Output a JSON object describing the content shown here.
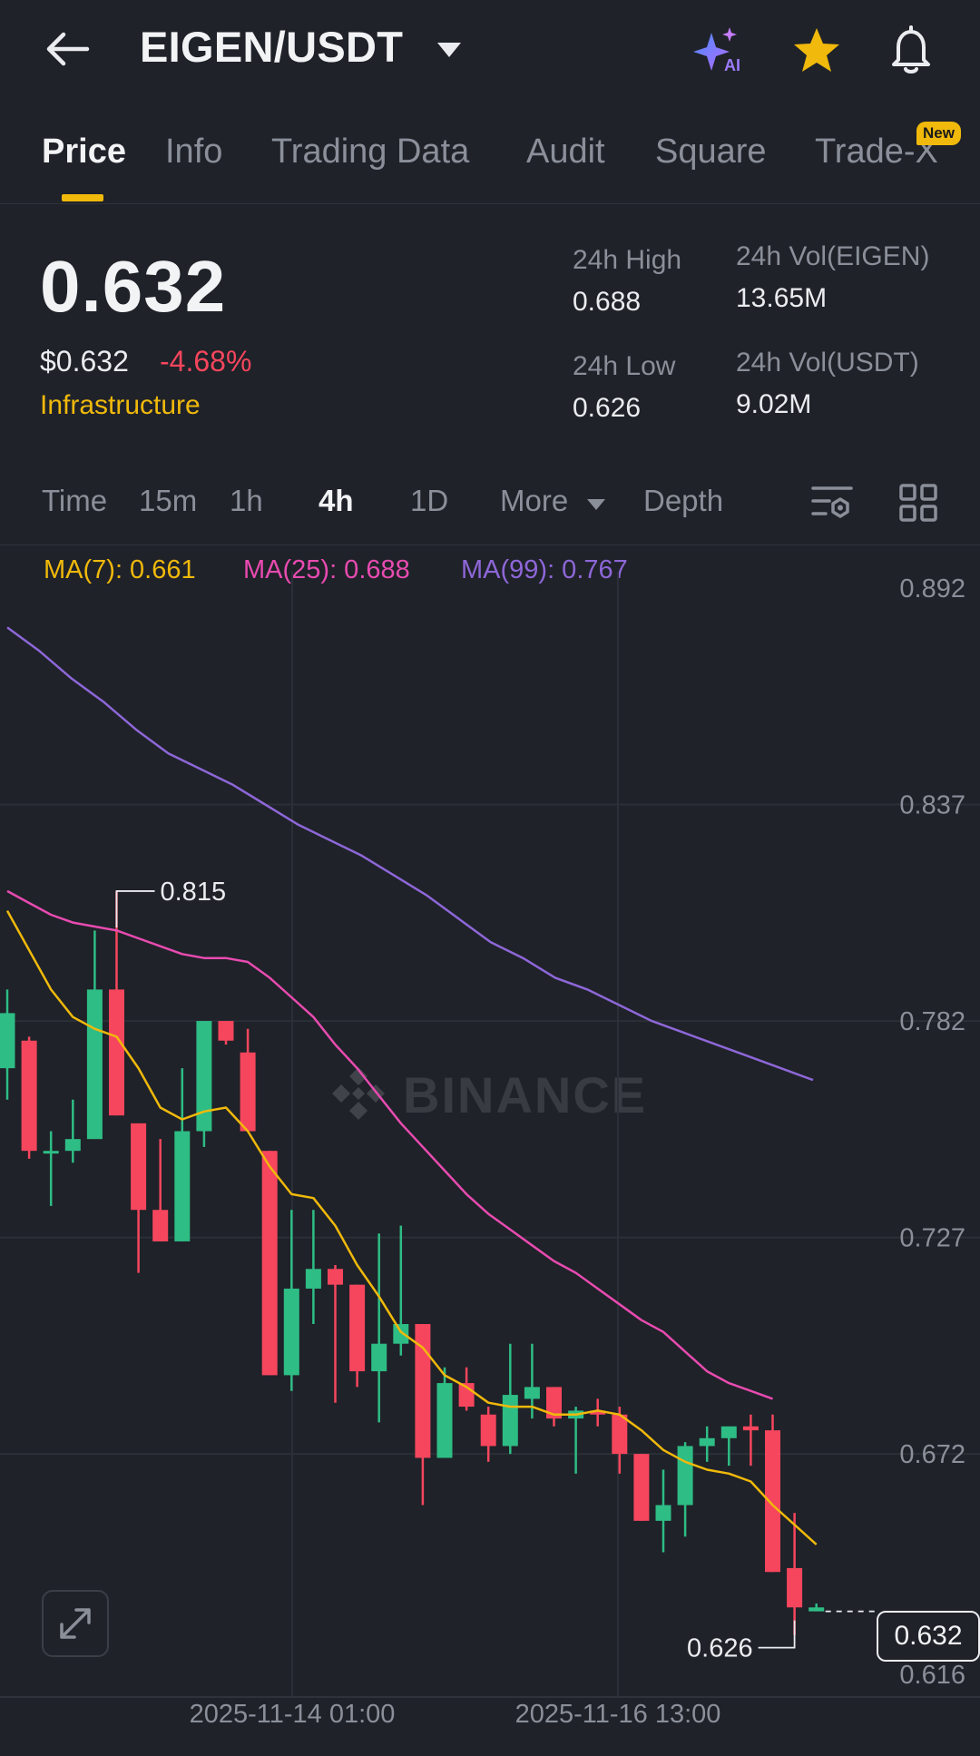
{
  "header": {
    "pair": "EIGEN/USDT",
    "icons": {
      "back": "arrow-left-icon",
      "caret": "caret-down-icon",
      "ai": "ai-sparkle-icon",
      "favorite": "star-icon",
      "alert": "bell-icon"
    },
    "favorite_color": "#f0b90b"
  },
  "tabs": [
    {
      "label": "Price",
      "active": true
    },
    {
      "label": "Info"
    },
    {
      "label": "Trading Data"
    },
    {
      "label": "Audit"
    },
    {
      "label": "Square"
    },
    {
      "label": "Trade-X",
      "badge": "New"
    }
  ],
  "price": {
    "last": "0.632",
    "usd": "$0.632",
    "change": "-4.68%",
    "category": "Infrastructure"
  },
  "stats": {
    "high_label": "24h High",
    "high_value": "0.688",
    "low_label": "24h Low",
    "low_value": "0.626",
    "vol_base_label": "24h Vol(EIGEN)",
    "vol_base_value": "13.65M",
    "vol_quote_label": "24h Vol(USDT)",
    "vol_quote_value": "9.02M"
  },
  "intervals": {
    "time": "Time",
    "m15": "15m",
    "h1": "1h",
    "h4": "4h",
    "d1": "1D",
    "more": "More",
    "depth": "Depth",
    "selected": "4h"
  },
  "ma_legend": {
    "ma7": "MA(7): 0.661",
    "ma25": "MA(25): 0.688",
    "ma99": "MA(99): 0.767"
  },
  "colors": {
    "up": "#2ebd85",
    "down": "#f6465d",
    "ma7": "#f0b90b",
    "ma25": "#e84bb0",
    "ma99": "#8e67d8",
    "accent": "#f0b90b"
  },
  "watermark": "BINANCE",
  "chart_data": {
    "type": "candlestick",
    "y_ticks": [
      "0.892",
      "0.837",
      "0.782",
      "0.727",
      "0.672",
      "0.616"
    ],
    "ylim": [
      0.616,
      0.892
    ],
    "x_labels": [
      "2025-11-14 01:00",
      "2025-11-16 13:00"
    ],
    "high_marker": "0.815",
    "low_marker": "0.626",
    "current_price": "0.632",
    "candles": [
      {
        "o": 0.77,
        "h": 0.79,
        "l": 0.762,
        "c": 0.784
      },
      {
        "o": 0.777,
        "h": 0.778,
        "l": 0.747,
        "c": 0.749
      },
      {
        "o": 0.749,
        "h": 0.754,
        "l": 0.735,
        "c": 0.749
      },
      {
        "o": 0.749,
        "h": 0.762,
        "l": 0.746,
        "c": 0.752
      },
      {
        "o": 0.752,
        "h": 0.805,
        "l": 0.752,
        "c": 0.79
      },
      {
        "o": 0.79,
        "h": 0.815,
        "l": 0.758,
        "c": 0.758
      },
      {
        "o": 0.756,
        "h": 0.756,
        "l": 0.718,
        "c": 0.734
      },
      {
        "o": 0.734,
        "h": 0.752,
        "l": 0.726,
        "c": 0.726
      },
      {
        "o": 0.726,
        "h": 0.77,
        "l": 0.726,
        "c": 0.754
      },
      {
        "o": 0.754,
        "h": 0.782,
        "l": 0.75,
        "c": 0.782
      },
      {
        "o": 0.782,
        "h": 0.782,
        "l": 0.776,
        "c": 0.777
      },
      {
        "o": 0.774,
        "h": 0.78,
        "l": 0.754,
        "c": 0.754
      },
      {
        "o": 0.749,
        "h": 0.749,
        "l": 0.692,
        "c": 0.692
      },
      {
        "o": 0.692,
        "h": 0.734,
        "l": 0.688,
        "c": 0.714
      },
      {
        "o": 0.714,
        "h": 0.734,
        "l": 0.705,
        "c": 0.719
      },
      {
        "o": 0.719,
        "h": 0.72,
        "l": 0.685,
        "c": 0.715
      },
      {
        "o": 0.715,
        "h": 0.715,
        "l": 0.689,
        "c": 0.693
      },
      {
        "o": 0.693,
        "h": 0.728,
        "l": 0.68,
        "c": 0.7
      },
      {
        "o": 0.7,
        "h": 0.73,
        "l": 0.697,
        "c": 0.705
      },
      {
        "o": 0.705,
        "h": 0.705,
        "l": 0.659,
        "c": 0.671
      },
      {
        "o": 0.671,
        "h": 0.694,
        "l": 0.671,
        "c": 0.69
      },
      {
        "o": 0.69,
        "h": 0.694,
        "l": 0.683,
        "c": 0.684
      },
      {
        "o": 0.682,
        "h": 0.684,
        "l": 0.67,
        "c": 0.674
      },
      {
        "o": 0.674,
        "h": 0.7,
        "l": 0.672,
        "c": 0.687
      },
      {
        "o": 0.686,
        "h": 0.7,
        "l": 0.681,
        "c": 0.689
      },
      {
        "o": 0.689,
        "h": 0.689,
        "l": 0.679,
        "c": 0.681
      },
      {
        "o": 0.681,
        "h": 0.684,
        "l": 0.667,
        "c": 0.683
      },
      {
        "o": 0.683,
        "h": 0.686,
        "l": 0.679,
        "c": 0.682
      },
      {
        "o": 0.682,
        "h": 0.684,
        "l": 0.667,
        "c": 0.672
      },
      {
        "o": 0.672,
        "h": 0.672,
        "l": 0.655,
        "c": 0.655
      },
      {
        "o": 0.655,
        "h": 0.668,
        "l": 0.647,
        "c": 0.659
      },
      {
        "o": 0.659,
        "h": 0.675,
        "l": 0.651,
        "c": 0.674
      },
      {
        "o": 0.674,
        "h": 0.679,
        "l": 0.67,
        "c": 0.676
      },
      {
        "o": 0.676,
        "h": 0.678,
        "l": 0.669,
        "c": 0.679
      },
      {
        "o": 0.679,
        "h": 0.682,
        "l": 0.669,
        "c": 0.678
      },
      {
        "o": 0.678,
        "h": 0.682,
        "l": 0.642,
        "c": 0.642
      },
      {
        "o": 0.643,
        "h": 0.657,
        "l": 0.626,
        "c": 0.633
      },
      {
        "o": 0.632,
        "h": 0.634,
        "l": 0.632,
        "c": 0.633
      }
    ],
    "ma7": [
      0.81,
      0.8,
      0.79,
      0.783,
      0.78,
      0.778,
      0.77,
      0.76,
      0.757,
      0.759,
      0.76,
      0.754,
      0.745,
      0.738,
      0.737,
      0.73,
      0.72,
      0.712,
      0.703,
      0.699,
      0.692,
      0.689,
      0.685,
      0.684,
      0.684,
      0.682,
      0.682,
      0.683,
      0.682,
      0.678,
      0.673,
      0.67,
      0.668,
      0.667,
      0.665,
      0.659,
      0.654,
      0.649
    ],
    "ma25": [
      0.815,
      0.812,
      0.809,
      0.807,
      0.806,
      0.805,
      0.803,
      0.801,
      0.799,
      0.798,
      0.798,
      0.797,
      0.793,
      0.788,
      0.783,
      0.776,
      0.77,
      0.763,
      0.756,
      0.75,
      0.744,
      0.738,
      0.733,
      0.729,
      0.725,
      0.721,
      0.718,
      0.714,
      0.71,
      0.706,
      0.703,
      0.698,
      0.693,
      0.69,
      0.688,
      0.686
    ],
    "ma99_start": [
      0.882,
      0.767
    ],
    "ma99": [
      0.882,
      0.876,
      0.869,
      0.863,
      0.856,
      0.85,
      0.846,
      0.842,
      0.837,
      0.832,
      0.828,
      0.824,
      0.819,
      0.814,
      0.808,
      0.802,
      0.798,
      0.793,
      0.79,
      0.786,
      0.782,
      0.779,
      0.776,
      0.773,
      0.77,
      0.767
    ]
  }
}
